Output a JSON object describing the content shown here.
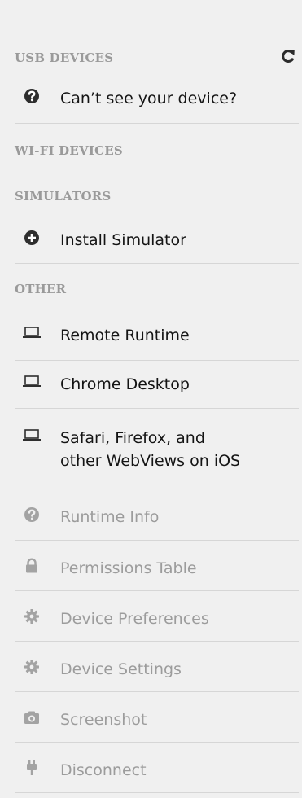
{
  "usb": {
    "header": "USB DEVICES",
    "refresh_icon": "refresh-icon",
    "help_item": {
      "icon": "question-circle-icon",
      "label": "Can’t see your device?"
    }
  },
  "wifi": {
    "header": "WI-FI DEVICES"
  },
  "simulators": {
    "header": "SIMULATORS",
    "install_item": {
      "icon": "plus-circle-icon",
      "label": "Install Simulator"
    }
  },
  "other": {
    "header": "OTHER",
    "items": [
      {
        "icon": "laptop-icon",
        "label": "Remote Runtime"
      },
      {
        "icon": "laptop-icon",
        "label": "Chrome Desktop"
      },
      {
        "icon": "laptop-icon",
        "label_line1": "Safari, Firefox, and",
        "label_line2": "other WebViews on iOS"
      }
    ]
  },
  "runtime_actions": [
    {
      "icon": "question-circle-icon",
      "label": "Runtime Info"
    },
    {
      "icon": "lock-icon",
      "label": "Permissions Table"
    },
    {
      "icon": "gear-icon",
      "label": "Device Preferences"
    },
    {
      "icon": "gear-icon",
      "label": "Device Settings"
    },
    {
      "icon": "camera-icon",
      "label": "Screenshot"
    },
    {
      "icon": "plug-icon",
      "label": "Disconnect"
    }
  ],
  "colors": {
    "background": "#f0f0f0",
    "header_text": "#9a9a9a",
    "item_text": "#141414",
    "muted_text": "#9c9c9c",
    "divider": "#d6d6d6"
  }
}
